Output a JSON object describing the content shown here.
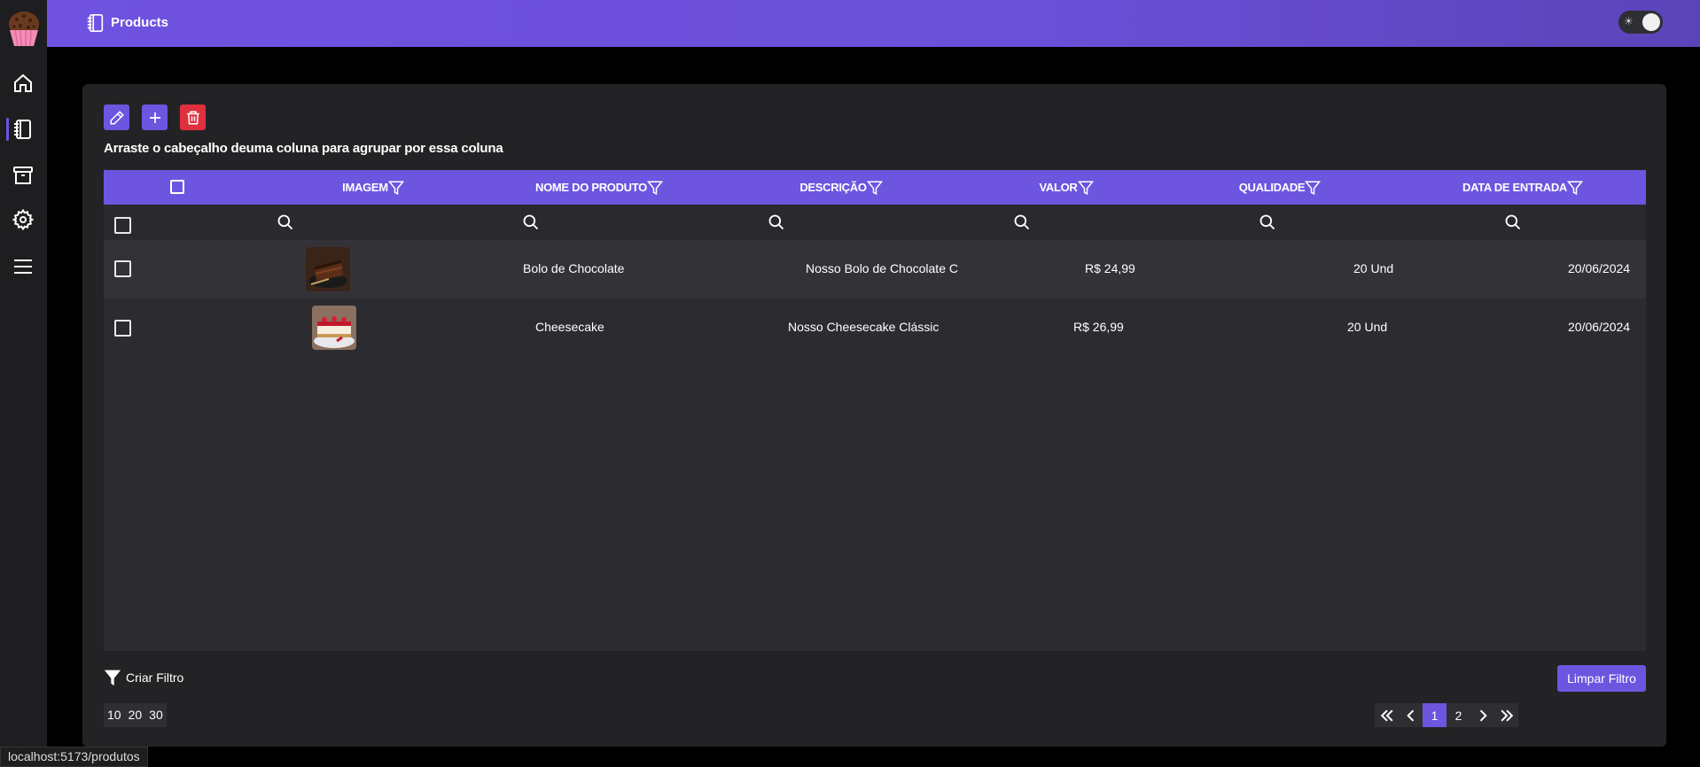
{
  "sidebar": {
    "logo": "cupcake-logo",
    "items": [
      {
        "name": "home-icon"
      },
      {
        "name": "notebook-icon",
        "active": true
      },
      {
        "name": "archive-icon"
      },
      {
        "name": "gear-icon"
      },
      {
        "name": "menu-icon"
      }
    ]
  },
  "header": {
    "title": "Products",
    "theme_toggle_icon": "sun-icon"
  },
  "toolbar": {
    "edit_icon": "pencil-icon",
    "add_icon": "plus-icon",
    "delete_icon": "trash-icon"
  },
  "grid": {
    "group_hint": "Arraste o cabeçalho deuma coluna para agrupar por essa coluna",
    "columns": [
      "IMAGEM",
      "NOME DO PRODUTO",
      "DESCRIÇÃO",
      "VALOR",
      "QUALIDADE",
      "DATA DE ENTRADA"
    ],
    "rows": [
      {
        "image": "chocolate-cake",
        "name": "Bolo de Chocolate",
        "description": "Nosso Bolo de Chocolate C",
        "value": "R$ 24,99",
        "quantity": "20 Und",
        "date": "20/06/2024"
      },
      {
        "image": "cheesecake",
        "name": "Cheesecake",
        "description": "Nosso Cheesecake Clássic",
        "value": "R$ 26,99",
        "quantity": "20 Und",
        "date": "20/06/2024"
      }
    ]
  },
  "footer": {
    "create_filter": "Criar Filtro",
    "clear_filter": "Limpar Filtro",
    "page_sizes": [
      "10",
      "20",
      "30"
    ],
    "pages": [
      "1",
      "2"
    ],
    "current_page": "1"
  },
  "status_url": "localhost:5173/produtos",
  "colors": {
    "accent": "#6d55e0",
    "danger": "#e0303f"
  }
}
